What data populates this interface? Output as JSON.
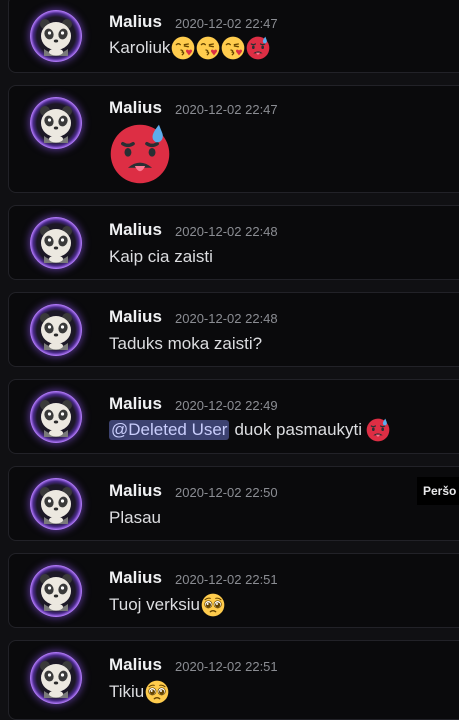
{
  "messages": [
    {
      "author": "Malius",
      "timestamp": "2020-12-02 22:47",
      "text": "Karoliuk",
      "emojis": [
        "kissing-heart",
        "kissing-heart",
        "kissing-heart",
        "hot-face"
      ]
    },
    {
      "author": "Malius",
      "timestamp": "2020-12-02 22:47",
      "text": "",
      "emojis": [
        "hot-face"
      ]
    },
    {
      "author": "Malius",
      "timestamp": "2020-12-02 22:48",
      "text": "Kaip cia zaisti",
      "emojis": []
    },
    {
      "author": "Malius",
      "timestamp": "2020-12-02 22:48",
      "text": "Taduks moka zaisti?",
      "emojis": []
    },
    {
      "author": "Malius",
      "timestamp": "2020-12-02 22:49",
      "mention": "@Deleted User",
      "text": "duok pasmaukyti",
      "emojis": [
        "hot-face"
      ]
    },
    {
      "author": "Malius",
      "timestamp": "2020-12-02 22:50",
      "text": "Plasau",
      "emojis": []
    },
    {
      "author": "Malius",
      "timestamp": "2020-12-02 22:51",
      "text": "Tuoj verksiu",
      "emojis": [
        "pleading-face"
      ]
    },
    {
      "author": "Malius",
      "timestamp": "2020-12-02 22:51",
      "text": "Tikiu",
      "emojis": [
        "pleading-face"
      ]
    }
  ],
  "tooltip": {
    "text": "Peršo"
  },
  "colors": {
    "background": "#101013",
    "card": "#0a0a0c",
    "mention_bg": "#3c4270",
    "avatar_ring": "#b57cff"
  }
}
